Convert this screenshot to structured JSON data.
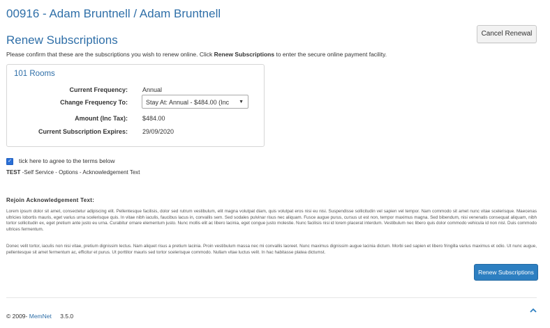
{
  "header": {
    "title": "00916 - Adam Bruntnell / Adam Bruntnell"
  },
  "section": {
    "title": "Renew Subscriptions",
    "cancel_label": "Cancel Renewal",
    "intro_prefix": "Please confirm that these are the subscriptions you wish to renew online. Click ",
    "intro_bold": "Renew Subscriptions",
    "intro_suffix": " to enter the secure online payment facility."
  },
  "subscription": {
    "name": "101 Rooms",
    "current_frequency_label": "Current Frequency:",
    "current_frequency_value": "Annual",
    "change_frequency_label": "Change Frequency To:",
    "change_frequency_selected": "Stay At: Annual - $484.00 (Inc",
    "amount_label": "Amount (Inc Tax):",
    "amount_value": "$484.00",
    "expires_label": "Current Subscription Expires:",
    "expires_value": "29/09/2020"
  },
  "terms": {
    "agree_label": "tick here to agree to the terms below",
    "checked": true,
    "ack_strong": "TEST",
    "ack_rest": " -Self Service - Options - Acknowledgement Text"
  },
  "rejoin": {
    "title": "Rejoin Acknowledgement Text:",
    "paragraph1": "Lorem ipsum dolor sit amet, consectetur adipiscing elit. Pellentesque facilisis, dolor sed rutrum vestibulum, elit magna volutpat diam, quis volutpat eros nisi eu nisi. Suspendisse sollicitudin vel sapien vel tempor. Nam commodo sit amet nunc vitae scelerisque. Maecenas ultricies lobortis mauris, eget varius urna scelerisque quis. In vitae nibh iaculis, faucibus lacus in, convallis sem. Sed sodales pulvinar risus nec aliquam. Fusce augue purus, cursus ut est non, tempor maximus magna. Sed bibendum, nisi venenatis consequat aliquam, nibh tortor sollicitudin ex, eget pretium ante justo eu urna. Curabitur ornare elementum justo. Nunc mollis elit ac libero lacinia, eget congue justo molestie. Nunc facilisis nisi id lorem placerat interdum. Vestibulum nec libero quis dolor commodo vehicula id non nisl. Duis commodo ultrices fermentum.",
    "paragraph2": "Donec velit tortor, iaculis non nisi vitae, pretium dignissim lectus. Nam aliquet risus a pretium lacinia. Proin vestibulum massa nec mi convallis laoreet. Nunc maximus dignissim augue lacinia dictum. Morbi sed sapien et libero fringilla varius maximus et odio. Ut nunc augue, pellentesque sit amet fermentum ac, efficitur et purus. Ut porttitor mauris sed tortor scelerisque commodo. Nullam vitae luctus velit. In hac habitasse platea dictumst."
  },
  "actions": {
    "renew_label": "Renew Subscriptions"
  },
  "footer": {
    "copyright": "© 2009-",
    "brand": "MemNet",
    "version": "3.5.0"
  },
  "colors": {
    "accent": "#2f6fa8",
    "primary_button": "#2d7fc1"
  },
  "icons": {
    "scroll_top": "chevron-up-icon",
    "select_arrow": "caret-down-icon",
    "checkbox": "check-icon"
  }
}
